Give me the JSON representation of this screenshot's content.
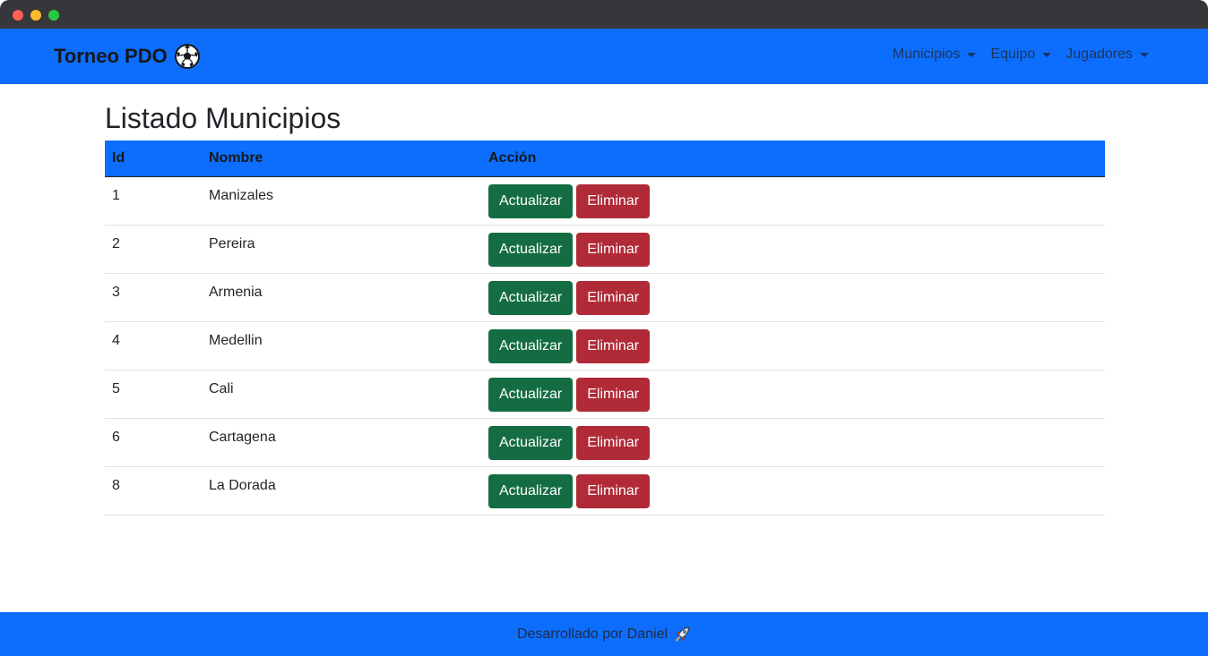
{
  "brand": {
    "title": "Torneo PDO"
  },
  "nav": {
    "items": [
      {
        "label": "Municipios"
      },
      {
        "label": "Equipo"
      },
      {
        "label": "Jugadores"
      }
    ]
  },
  "page": {
    "title": "Listado Municipios"
  },
  "table": {
    "headers": [
      "Id",
      "Nombre",
      "Acción"
    ],
    "rows": [
      {
        "id": "1",
        "nombre": "Manizales"
      },
      {
        "id": "2",
        "nombre": "Pereira"
      },
      {
        "id": "3",
        "nombre": "Armenia"
      },
      {
        "id": "4",
        "nombre": "Medellin"
      },
      {
        "id": "5",
        "nombre": "Cali"
      },
      {
        "id": "6",
        "nombre": "Cartagena"
      },
      {
        "id": "8",
        "nombre": "La Dorada"
      }
    ],
    "update_label": "Actualizar",
    "delete_label": "Eliminar"
  },
  "footer": {
    "text": "Desarrollado por Daniel"
  },
  "colors": {
    "primary": "#0d6efd",
    "success": "#146c43",
    "danger": "#b02a37"
  },
  "icons": {
    "brand": "soccer-ball-icon",
    "footer": "rocket-icon"
  }
}
